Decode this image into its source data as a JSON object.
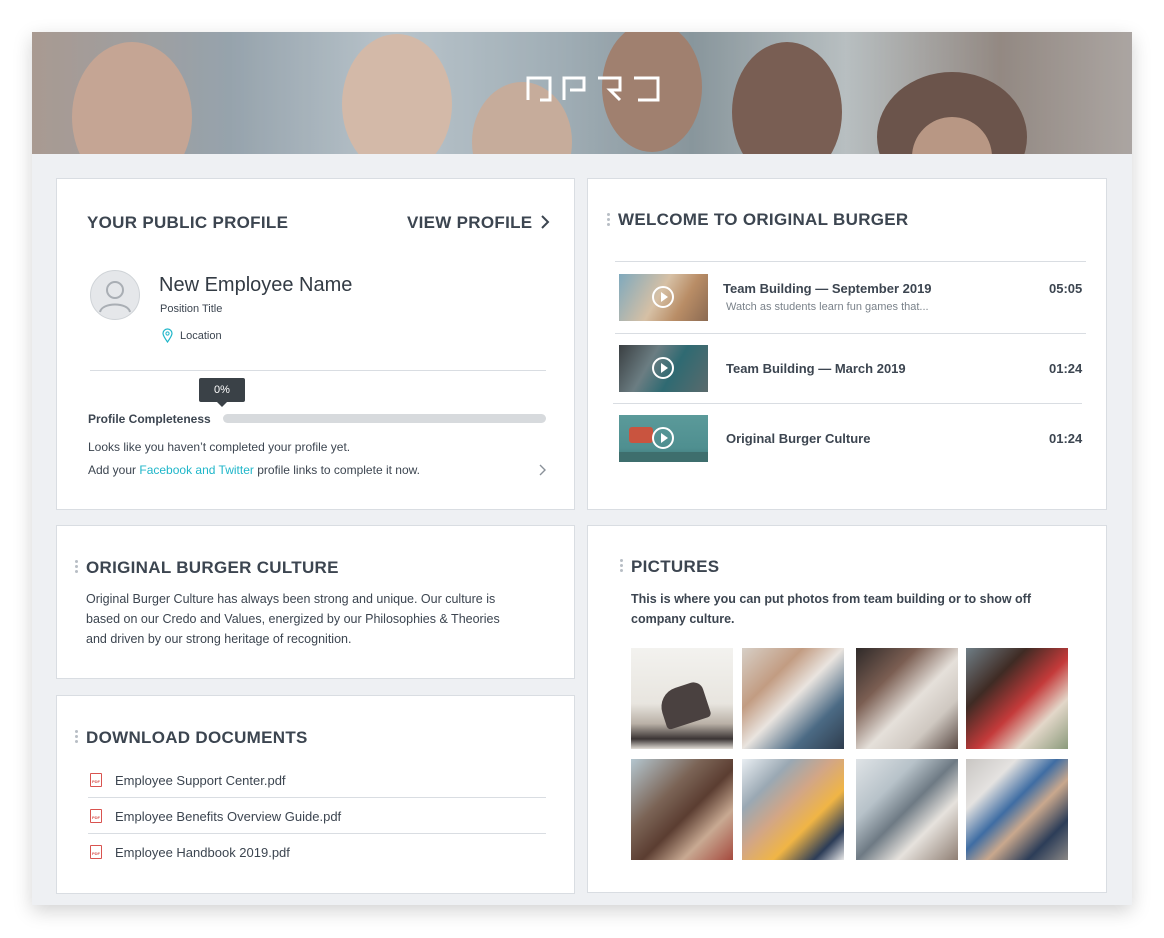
{
  "colors": {
    "accent": "#1fb6c9",
    "text": "#3c4550",
    "progress_track": "#d7dadd"
  },
  "profile": {
    "title": "YOUR PUBLIC PROFILE",
    "view_link": "VIEW PROFILE",
    "name": "New Employee Name",
    "position": "Position Title",
    "location": "Location",
    "progress_label": "0%",
    "progress_value": 0,
    "completeness_label": "Profile Completeness",
    "message": "Looks like you haven’t completed your profile yet.",
    "add_prefix": "Add your ",
    "add_link": "Facebook and Twitter",
    "add_suffix": " profile links to complete it now."
  },
  "welcome": {
    "title": "WELCOME TO ORIGINAL BURGER",
    "videos": [
      {
        "title": "Team Building — September 2019",
        "description": "Watch as students learn fun games that...",
        "duration": "05:05"
      },
      {
        "title": "Team Building — March 2019",
        "description": "",
        "duration": "01:24"
      },
      {
        "title": "Original Burger Culture",
        "description": "",
        "duration": "01:24"
      }
    ]
  },
  "culture": {
    "title": "ORIGINAL BURGER CULTURE",
    "lines": [
      "Original Burger Culture has always been strong and unique. Our culture is",
      "based on our Credo and Values, energized by our Philosophies & Theories",
      "and driven by our strong heritage of recognition."
    ]
  },
  "documents": {
    "title": "DOWNLOAD DOCUMENTS",
    "files": [
      "Employee Support Center.pdf",
      "Employee Benefits Overview Guide.pdf",
      "Employee Handbook 2019.pdf"
    ],
    "icon_text": "PDF"
  },
  "pictures": {
    "title": "PICTURES",
    "lines": [
      "This is where you can put photos from team building or to show off",
      "company culture."
    ]
  }
}
